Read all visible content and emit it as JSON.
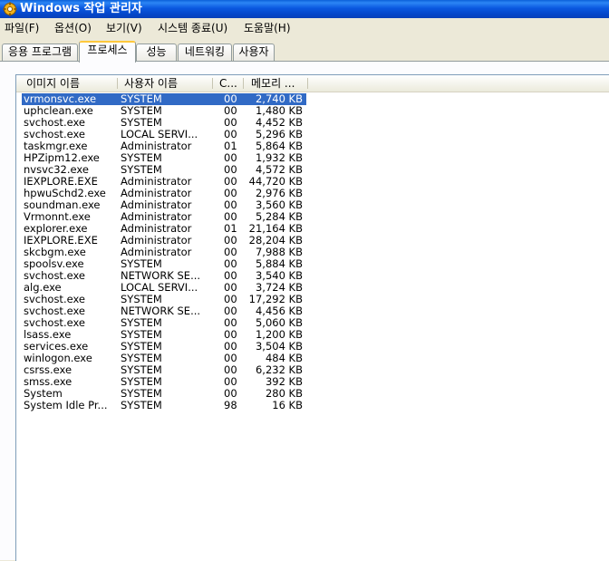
{
  "window": {
    "title": "Windows 작업 관리자"
  },
  "menu": [
    "파일(F)",
    "옵션(O)",
    "보기(V)",
    "시스템 종료(U)",
    "도움말(H)"
  ],
  "tabs": [
    {
      "label": "응용 프로그램",
      "active": false
    },
    {
      "label": "프로세스",
      "active": true
    },
    {
      "label": "성능",
      "active": false
    },
    {
      "label": "네트워킹",
      "active": false
    },
    {
      "label": "사용자",
      "active": false
    }
  ],
  "columns": {
    "image_name": "이미지 이름",
    "user_name": "사용자 이름",
    "cpu": "C...",
    "memory": "메모리 ..."
  },
  "processes": [
    {
      "name": "vrmonsvc.exe",
      "user": "SYSTEM",
      "cpu": "00",
      "mem": "2,740 KB",
      "selected": true
    },
    {
      "name": "uphclean.exe",
      "user": "SYSTEM",
      "cpu": "00",
      "mem": "1,480 KB"
    },
    {
      "name": "svchost.exe",
      "user": "SYSTEM",
      "cpu": "00",
      "mem": "4,452 KB"
    },
    {
      "name": "svchost.exe",
      "user": "LOCAL SERVI...",
      "cpu": "00",
      "mem": "5,296 KB"
    },
    {
      "name": "taskmgr.exe",
      "user": "Administrator",
      "cpu": "01",
      "mem": "5,864 KB"
    },
    {
      "name": "HPZipm12.exe",
      "user": "SYSTEM",
      "cpu": "00",
      "mem": "1,932 KB"
    },
    {
      "name": "nvsvc32.exe",
      "user": "SYSTEM",
      "cpu": "00",
      "mem": "4,572 KB"
    },
    {
      "name": "IEXPLORE.EXE",
      "user": "Administrator",
      "cpu": "00",
      "mem": "44,720 KB"
    },
    {
      "name": "hpwuSchd2.exe",
      "user": "Administrator",
      "cpu": "00",
      "mem": "2,976 KB"
    },
    {
      "name": "soundman.exe",
      "user": "Administrator",
      "cpu": "00",
      "mem": "3,560 KB"
    },
    {
      "name": "Vrmonnt.exe",
      "user": "Administrator",
      "cpu": "00",
      "mem": "5,284 KB"
    },
    {
      "name": "explorer.exe",
      "user": "Administrator",
      "cpu": "01",
      "mem": "21,164 KB"
    },
    {
      "name": "IEXPLORE.EXE",
      "user": "Administrator",
      "cpu": "00",
      "mem": "28,204 KB"
    },
    {
      "name": "skcbgm.exe",
      "user": "Administrator",
      "cpu": "00",
      "mem": "7,988 KB"
    },
    {
      "name": "spoolsv.exe",
      "user": "SYSTEM",
      "cpu": "00",
      "mem": "5,884 KB"
    },
    {
      "name": "svchost.exe",
      "user": "NETWORK SE...",
      "cpu": "00",
      "mem": "3,540 KB"
    },
    {
      "name": "alg.exe",
      "user": "LOCAL SERVI...",
      "cpu": "00",
      "mem": "3,724 KB"
    },
    {
      "name": "svchost.exe",
      "user": "SYSTEM",
      "cpu": "00",
      "mem": "17,292 KB"
    },
    {
      "name": "svchost.exe",
      "user": "NETWORK SE...",
      "cpu": "00",
      "mem": "4,456 KB"
    },
    {
      "name": "svchost.exe",
      "user": "SYSTEM",
      "cpu": "00",
      "mem": "5,060 KB"
    },
    {
      "name": "lsass.exe",
      "user": "SYSTEM",
      "cpu": "00",
      "mem": "1,200 KB"
    },
    {
      "name": "services.exe",
      "user": "SYSTEM",
      "cpu": "00",
      "mem": "3,504 KB"
    },
    {
      "name": "winlogon.exe",
      "user": "SYSTEM",
      "cpu": "00",
      "mem": "484 KB"
    },
    {
      "name": "csrss.exe",
      "user": "SYSTEM",
      "cpu": "00",
      "mem": "6,232 KB"
    },
    {
      "name": "smss.exe",
      "user": "SYSTEM",
      "cpu": "00",
      "mem": "392 KB"
    },
    {
      "name": "System",
      "user": "SYSTEM",
      "cpu": "00",
      "mem": "280 KB"
    },
    {
      "name": "System Idle Pr...",
      "user": "SYSTEM",
      "cpu": "98",
      "mem": "16 KB"
    }
  ],
  "colors": {
    "titlebar": "#0A58E0",
    "selection": "#316AC5",
    "active_tab_accent": "#FFC83C"
  }
}
